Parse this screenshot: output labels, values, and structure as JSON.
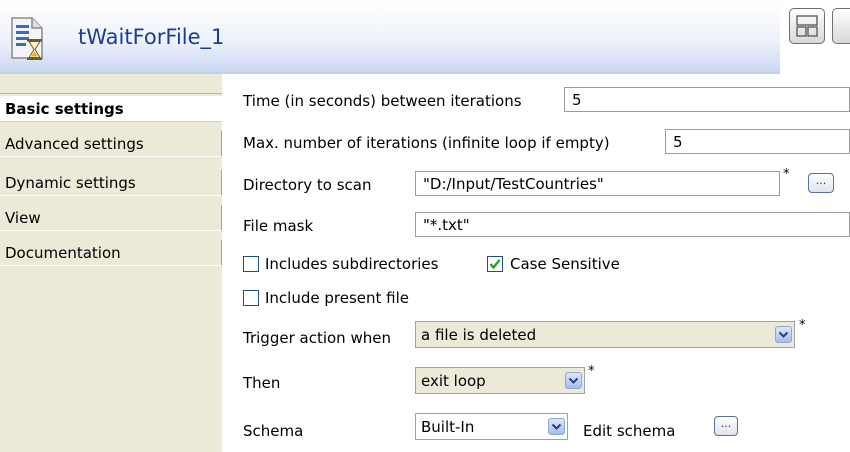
{
  "header": {
    "title": "tWaitForFile_1",
    "icon": "hourglass-file-icon"
  },
  "tabs": [
    {
      "label": "Basic settings",
      "active": true
    },
    {
      "label": "Advanced settings"
    },
    {
      "label": "Dynamic settings"
    },
    {
      "label": "View"
    },
    {
      "label": "Documentation"
    }
  ],
  "form": {
    "time_label": "Time (in seconds) between iterations",
    "time_value": "5",
    "max_label": "Max. number of iterations (infinite loop if empty)",
    "max_value": "5",
    "dir_label": "Directory to scan",
    "dir_value": "\"D:/Input/TestCountries\"",
    "mask_label": "File mask",
    "mask_value": "\"*.txt\"",
    "includes_sub_label": "Includes subdirectories",
    "includes_sub_checked": false,
    "case_label": "Case Sensitive",
    "case_checked": true,
    "include_present_label": "Include present file",
    "include_present_checked": false,
    "trigger_label": "Trigger action when",
    "trigger_value": "a file is deleted",
    "then_label": "Then",
    "then_value": "exit loop",
    "schema_label": "Schema",
    "schema_value": "Built-In",
    "edit_schema_label": "Edit schema",
    "required_marker": "*",
    "browse_label": "..."
  },
  "colors": {
    "title": "#1d3c97",
    "tab_bg": "#ece9d8",
    "check_mark": "#21a121"
  }
}
